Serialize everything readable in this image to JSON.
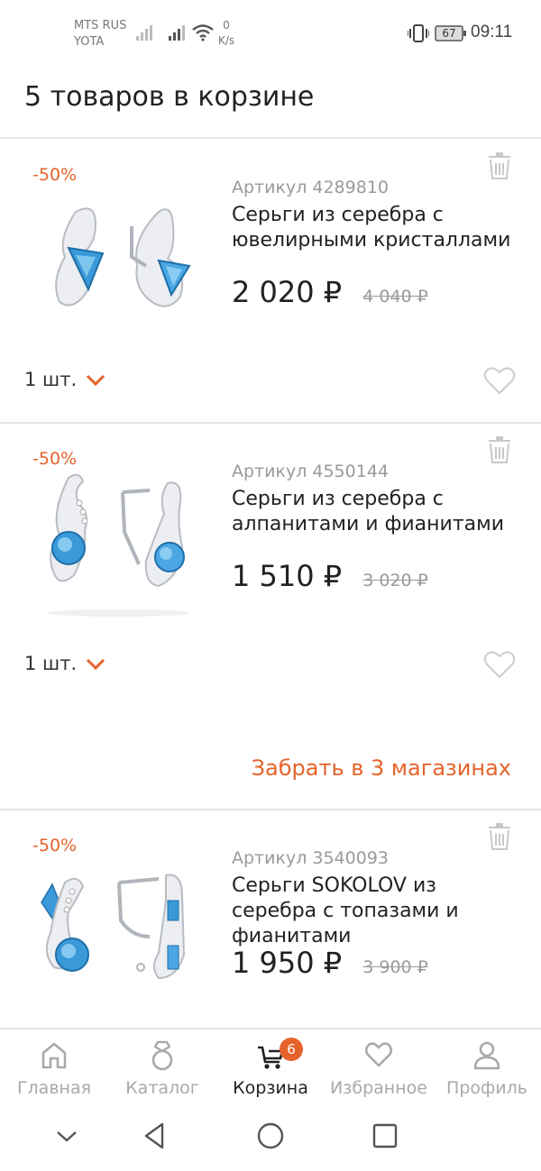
{
  "status_bar": {
    "carrier_1": "MTS RUS",
    "carrier_2": "YOTA",
    "net_speed_value": "0",
    "net_speed_unit": "K/s",
    "battery": "67",
    "time": "09:11"
  },
  "header": {
    "title": "5 товаров в корзине"
  },
  "cart": {
    "items": [
      {
        "discount": "-50%",
        "sku": "Артикул 4289810",
        "name": "Серьги из серебра с ювелирными кристаллами",
        "price": "2 020 ₽",
        "old_price": "4 040 ₽",
        "quantity": "1 шт."
      },
      {
        "discount": "-50%",
        "sku": "Артикул 4550144",
        "name": "Серьги из серебра с алпанитами и фианитами",
        "price": "1 510 ₽",
        "old_price": "3 020 ₽",
        "quantity": "1 шт.",
        "pickup_link": "Забрать в 3 магазинах"
      },
      {
        "discount": "-50%",
        "sku": "Артикул 3540093",
        "name": "Серьги SOKOLOV из серебра с топазами и фианитами",
        "price": "1 950 ₽",
        "old_price": "3 900 ₽"
      }
    ]
  },
  "bottom_nav": {
    "items": [
      {
        "label": "Главная",
        "icon": "home-icon"
      },
      {
        "label": "Каталог",
        "icon": "ring-icon"
      },
      {
        "label": "Корзина",
        "icon": "cart-icon",
        "badge": "6",
        "active": true
      },
      {
        "label": "Избранное",
        "icon": "heart-icon"
      },
      {
        "label": "Профиль",
        "icon": "profile-icon"
      }
    ]
  },
  "colors": {
    "accent": "#e5632b",
    "muted_text": "#9a9a9a",
    "divider": "#e6e6e6",
    "gem_blue": "#3a9ad9"
  }
}
